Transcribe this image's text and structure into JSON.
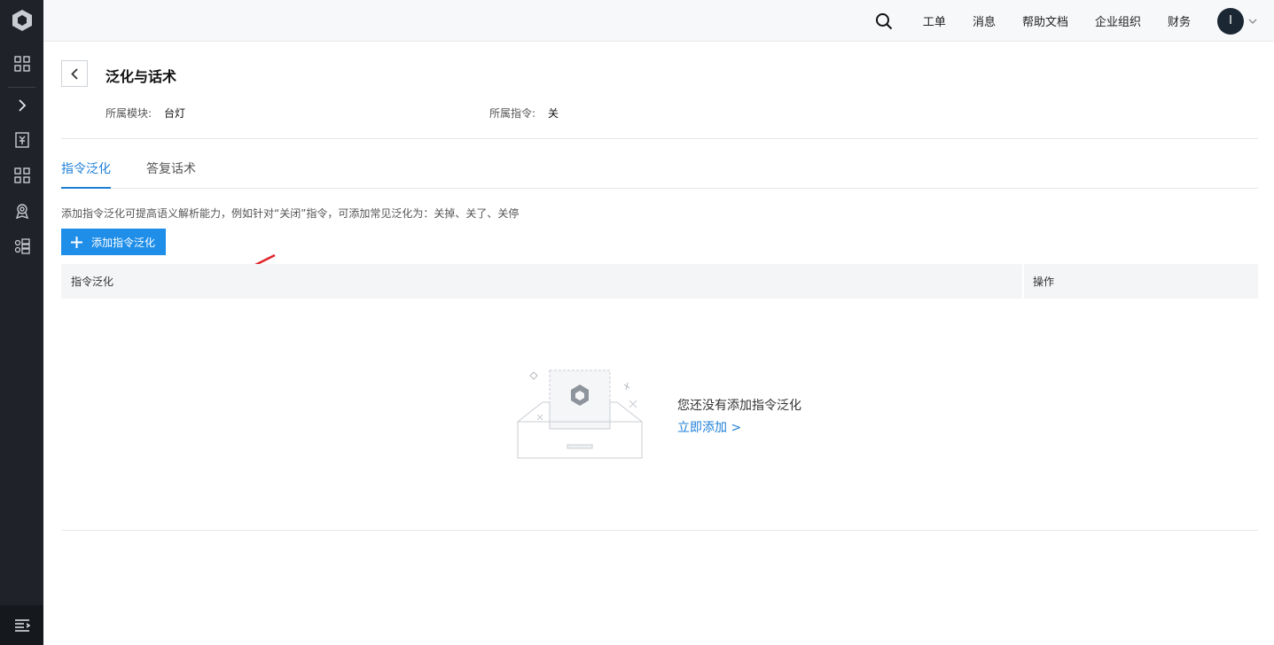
{
  "topbar": {
    "nav": [
      "工单",
      "消息",
      "帮助文档",
      "企业组织",
      "财务"
    ],
    "avatar_initial": "I"
  },
  "sidebar": {
    "icons": [
      "logo-icon",
      "dashboard-icon",
      "expand-icon",
      "document-icon",
      "apps-icon",
      "award-icon",
      "modules-icon",
      "menu-icon"
    ]
  },
  "page": {
    "title": "泛化与话术",
    "module_label": "所属模块:",
    "module_value": "台灯",
    "command_label": "所属指令:",
    "command_value": "关"
  },
  "tabs": [
    {
      "label": "指令泛化",
      "active": true
    },
    {
      "label": "答复话术",
      "active": false
    }
  ],
  "tip": "添加指令泛化可提高语义解析能力，例如针对“关闭”指令，可添加常见泛化为：关掉、关了、关停",
  "add_button": "添加指令泛化",
  "table": {
    "columns": [
      "指令泛化",
      "操作"
    ]
  },
  "empty": {
    "message": "您还没有添加指令泛化",
    "link": "立即添加 >"
  },
  "colors": {
    "sidebar_bg": "#1f2329",
    "accent": "#1e7fd7",
    "button_bg": "#1e8ee9",
    "annotation_arrow": "#e0262b"
  }
}
